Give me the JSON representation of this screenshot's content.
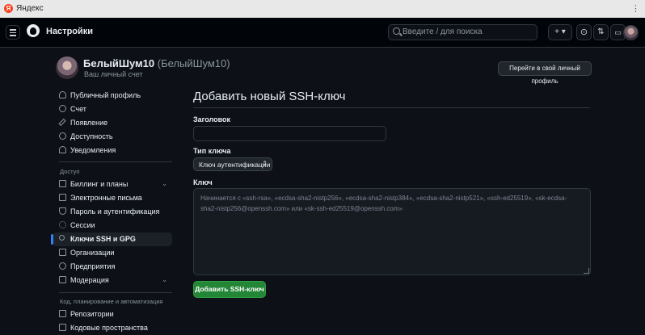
{
  "browser": {
    "title": "Яндекс",
    "logo_letter": "Я",
    "menu": "⋮"
  },
  "header": {
    "title": "Настройки",
    "search_placeholder": "Введите / для поиска",
    "plus_label": "+ ▾",
    "issues_icon": "⊙",
    "pr_icon": "⇅",
    "inbox_icon": "▭"
  },
  "profile": {
    "display_name": "БелыйШум10",
    "login": "(БелыйШум10)",
    "subtitle": "Ваш личный счет",
    "go_profile_button": "Перейти в свой личный профиль"
  },
  "sidebar": {
    "top_items": [
      {
        "label": "Публичный профиль",
        "icon": "person-icon"
      },
      {
        "label": "Счет",
        "icon": "gear-icon"
      },
      {
        "label": "Появление",
        "icon": "paintbrush-icon"
      },
      {
        "label": "Доступность",
        "icon": "accessibility-icon"
      },
      {
        "label": "Уведомления",
        "icon": "bell-icon"
      }
    ],
    "access_heading": "Доступ",
    "access_items": [
      {
        "label": "Биллинг и планы",
        "icon": "credit-card-icon",
        "expandable": true
      },
      {
        "label": "Электронные письма",
        "icon": "mail-icon"
      },
      {
        "label": "Пароль и аутентификация",
        "icon": "shield-lock-icon"
      },
      {
        "label": "Сессии",
        "icon": "broadcast-icon"
      },
      {
        "label": "Ключи SSH и GPG",
        "icon": "key-icon",
        "active": true
      },
      {
        "label": "Организации",
        "icon": "table-icon"
      },
      {
        "label": "Предприятия",
        "icon": "globe-icon"
      },
      {
        "label": "Модерация",
        "icon": "comment-icon",
        "expandable": true
      }
    ],
    "code_heading": "Код, планирование и автоматизация",
    "code_items": [
      {
        "label": "Репозитории",
        "icon": "repo-icon"
      },
      {
        "label": "Кодовые пространства",
        "icon": "codespaces-icon"
      }
    ],
    "chevron": "⌄"
  },
  "main": {
    "title": "Добавить новый SSH-ключ",
    "title_label": "Заголовок",
    "title_value": "",
    "key_type_label": "Тип ключа",
    "key_type_value": "Ключ аутентификации",
    "key_type_chevron": "⇕",
    "key_label": "Ключ",
    "key_placeholder": "Начинается с «ssh-rsa», «ecdsa-sha2-nistp256», «ecdsa-sha2-nistp384», «ecdsa-sha2-nistp521», «ssh-ed25519», «sk-ecdsa-sha2-nistp256@openssh.com» или «sk-ssh-ed25519@openssh.com»",
    "submit_button": "Добавить SSH-ключ"
  },
  "colors": {
    "accent": "#2f81f7",
    "primary_button": "#238636",
    "background": "#0d1117"
  }
}
